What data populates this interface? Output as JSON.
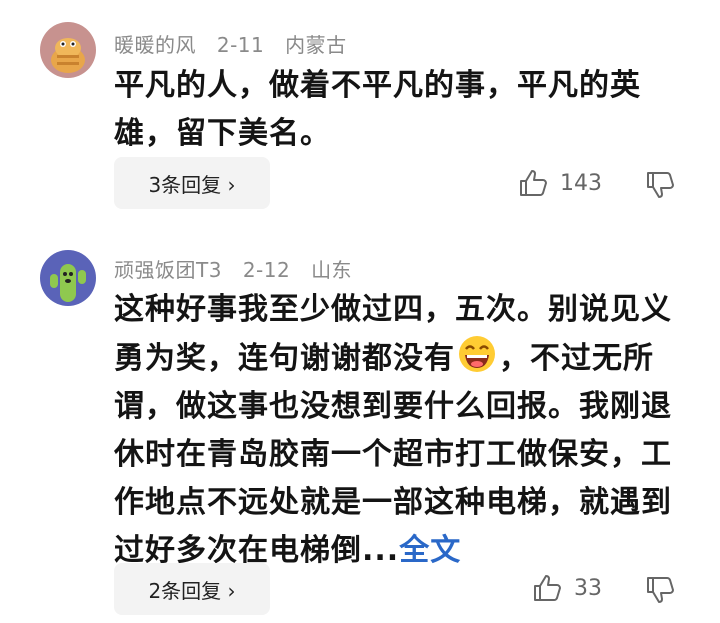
{
  "comments": [
    {
      "user": "暖暖的风",
      "date": "2-11",
      "location": "内蒙古",
      "text": "平凡的人，做着不平凡的事，平凡的英雄，留下美名。",
      "reply_label": "3条回复 ›",
      "likes": "143"
    },
    {
      "user": "顽强饭团T3",
      "date": "2-12",
      "location": "山东",
      "text_before_emoji": "这种好事我至少做过四，五次。别说见义勇为奖，连句谢谢都没有",
      "text_after_emoji": "，不过无所谓，做这事也没想到要什么回报。我刚退休时在青岛胶南一个超市打工做保安，工作地点不远处就是一部这种电梯，就遇到过好多次在电梯倒...",
      "more_label": "全文",
      "reply_label": "2条回复 ›",
      "likes": "33"
    }
  ],
  "icons": {
    "like": "thumbs-up-icon",
    "dislike": "thumbs-down-icon",
    "emoji": "laughing-emoji-icon"
  },
  "colors": {
    "link": "#2a68c8",
    "meta": "#8a8a8a",
    "reply_bg": "#f3f3f3"
  }
}
